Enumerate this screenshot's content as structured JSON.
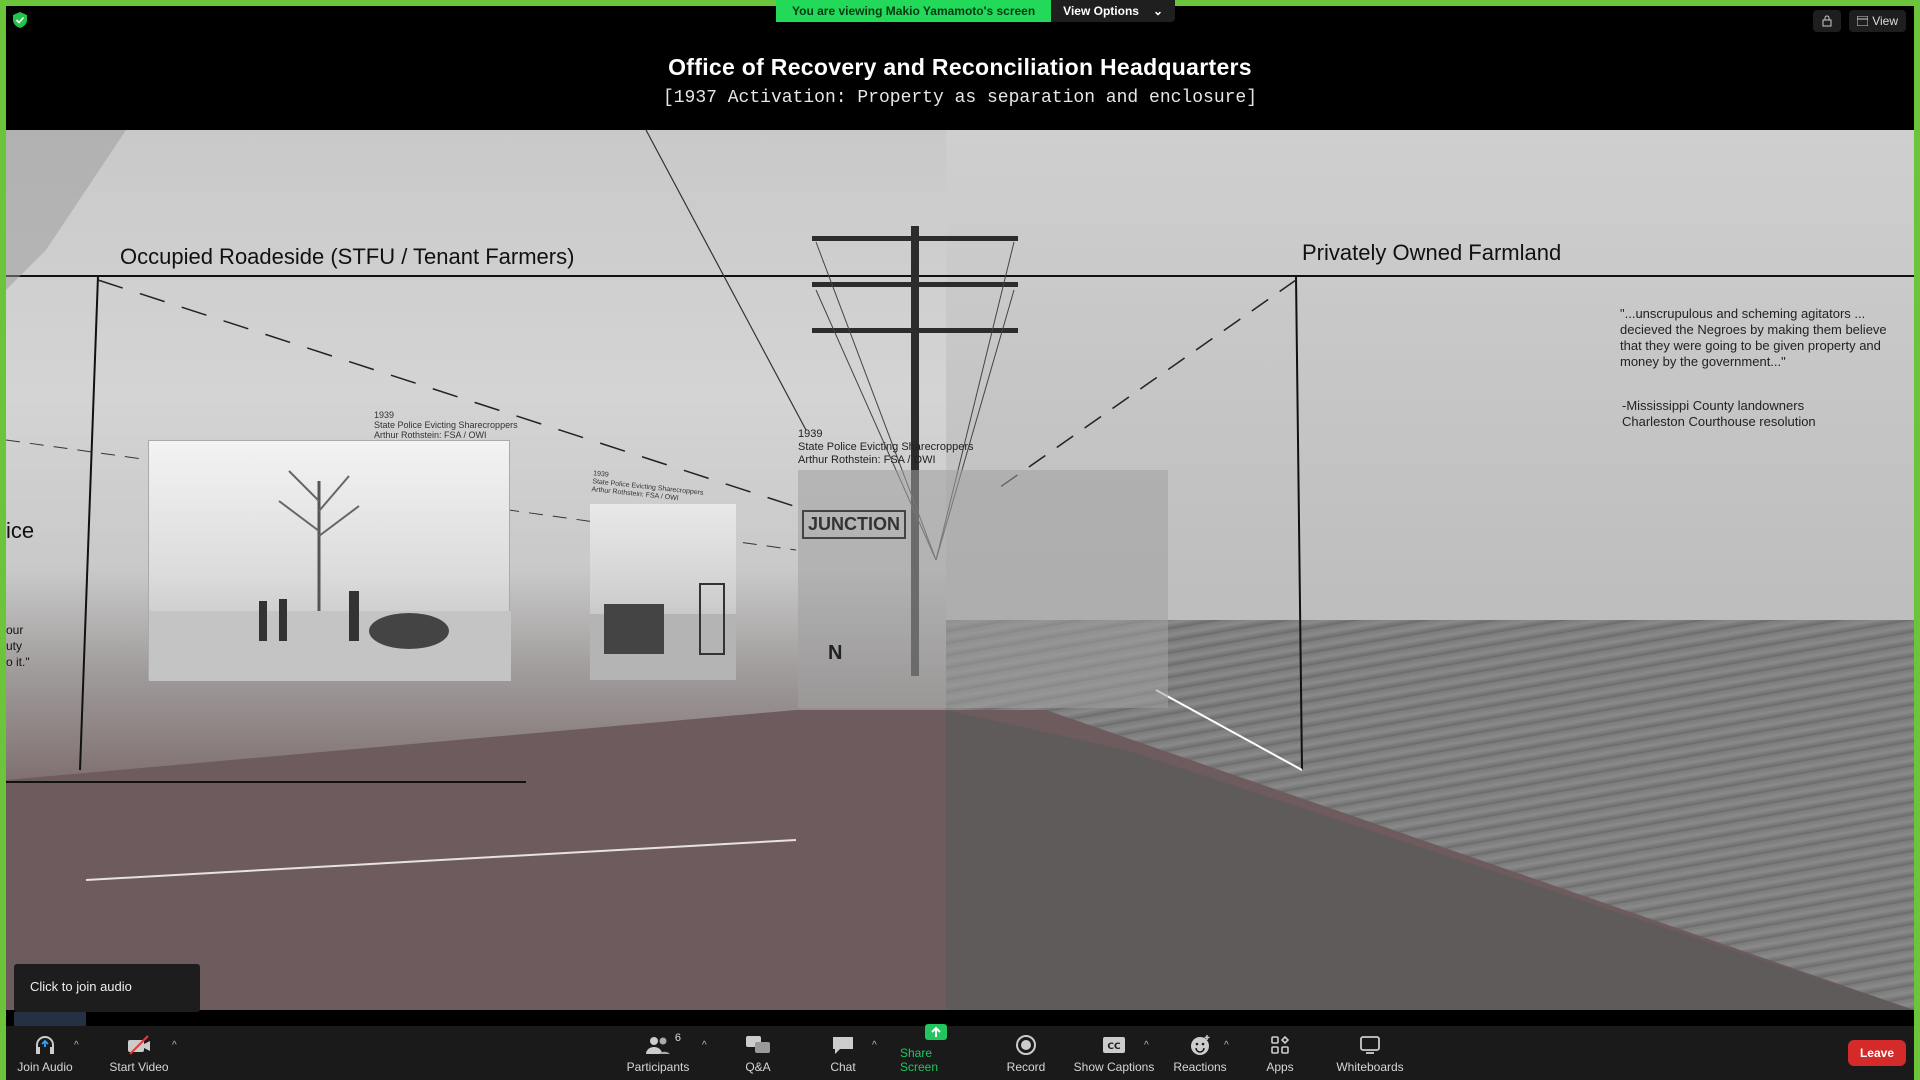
{
  "banner": {
    "viewing_text": "You are viewing Makio Yamamoto's screen",
    "view_options_label": "View Options"
  },
  "top_right": {
    "view_label": "View"
  },
  "shared": {
    "title": "Office of Recovery and Reconciliation  Headquarters",
    "subtitle": "[1937 Activation: Property as separation and enclosure]",
    "left_heading": "Occupied Roadeside (STFU / Tenant Farmers)",
    "right_heading": "Privately Owned Farmland",
    "clipped_left_word": "ice",
    "clipped_left_quote": "our\nuty\no it.\"",
    "photo1_caption_year": "1939",
    "photo1_caption_line1": "State Police Evicting Sharecroppers",
    "photo1_caption_line2": "Arthur Rothstein: FSA / OWI",
    "photo2_caption_year": "1939",
    "photo2_caption_line1": "State Police Evicting Sharecroppers",
    "photo2_caption_line2": "Arthur Rothstein: FSA / OWI",
    "photo3_caption_year": "1939",
    "photo3_caption_line1": "State Police Evicting Sharecroppers",
    "photo3_caption_line2": "Arthur Rothstein: FSA / OWI",
    "sign_text": "JUNCTION",
    "sign_letter": "N",
    "quote_text": "\"...unscrupulous and scheming agitators ... decieved the Negroes by making them believe that they were going to be given property and money by the government...\"",
    "quote_source_line1": "-Mississippi County landowners",
    "quote_source_line2": "Charleston Courthouse resolution"
  },
  "join_audio_tip": "Click to join audio",
  "toolbar": {
    "join_audio": "Join Audio",
    "start_video": "Start Video",
    "participants": "Participants",
    "participants_count": "6",
    "qa": "Q&A",
    "chat": "Chat",
    "share_screen": "Share Screen",
    "record": "Record",
    "show_captions": "Show Captions",
    "reactions": "Reactions",
    "apps": "Apps",
    "whiteboards": "Whiteboards",
    "leave": "Leave"
  },
  "colors": {
    "share_border": "#6bc43a",
    "banner_green": "#23d959",
    "leave_red": "#d42a2a",
    "share_active": "#22c55e"
  }
}
